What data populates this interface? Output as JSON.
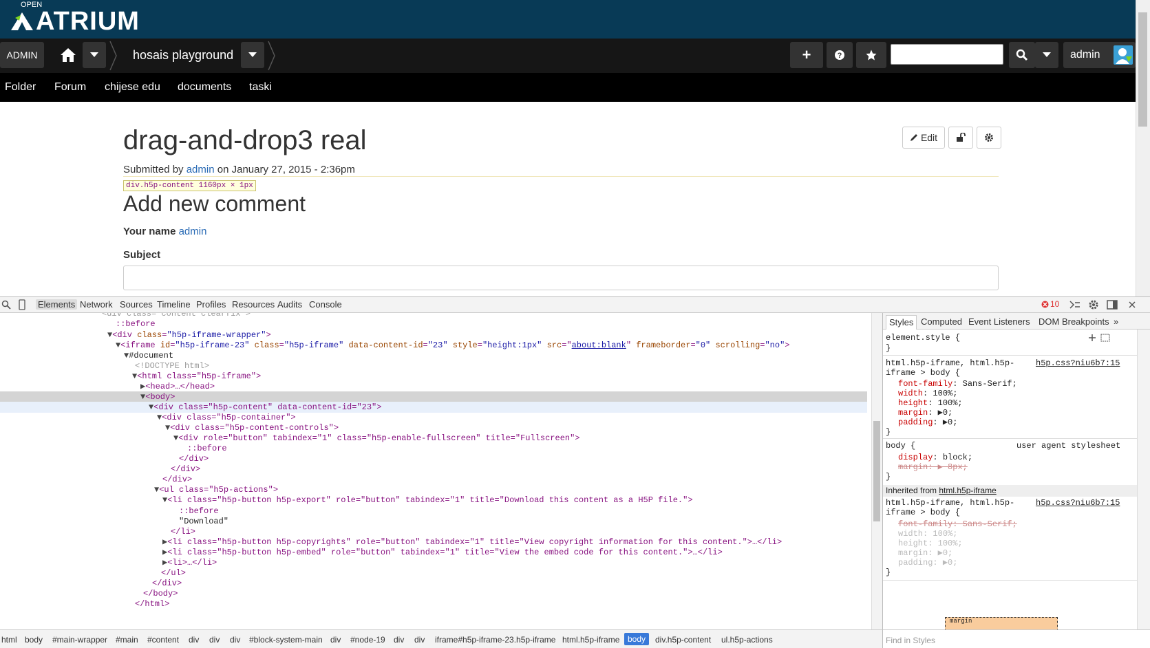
{
  "brand": {
    "small": "OPEN",
    "name": "ATRIUM"
  },
  "toolbar": {
    "admin_label": "ADMIN",
    "space_name": "hosais playground",
    "plus": "+",
    "user_name": "admin",
    "search_value": ""
  },
  "spacebar": {
    "items": [
      "Folder",
      "Forum",
      "chijese edu",
      "documents",
      "taski"
    ]
  },
  "content": {
    "title": "drag-and-drop3 real",
    "submitted_prefix": "Submitted by ",
    "author": "admin",
    "submitted_suffix": " on January 27, 2015 - 2:36pm",
    "tooltip": "div.h5p-content 1160px × 1px",
    "comment_heading": "Add new comment",
    "your_name_label": "Your name",
    "your_name_value": "admin",
    "subject_label": "Subject",
    "edit_label": "Edit"
  },
  "devtools": {
    "tabs": [
      "Elements",
      "Network",
      "Sources",
      "Timeline",
      "Profiles",
      "Resources",
      "Audits",
      "Console"
    ],
    "active_tab": "Elements",
    "error_count": "10",
    "styles_tabs": [
      "Styles",
      "Computed",
      "Event Listeners",
      "DOM Breakpoints"
    ],
    "styles_active": "Styles",
    "inherited_label": "Inherited from ",
    "inherited_link": "html.h5p-iframe",
    "find_placeholder": "Find in Styles",
    "box_model_label": "margin",
    "breadcrumbs": [
      "html",
      "body",
      "#main-wrapper",
      "#main",
      "#content",
      "div",
      "div",
      "div",
      "#block-system-main",
      "div",
      "#node-19",
      "div",
      "div",
      "iframe#h5p-iframe-23.h5p-iframe",
      "html.h5p-iframe",
      "body",
      "div.h5p-content",
      "ul.h5p-actions"
    ],
    "breadcrumb_active": "body"
  },
  "dom": {
    "l0": "<div class=\"content clearfix\">",
    "l1": "::before",
    "l2_tag": "<div ",
    "l2_an": "class",
    "l2_av": "\"h5p-iframe-wrapper\"",
    "l2_end": ">",
    "l3": "<iframe ",
    "l3_a1": "id",
    "l3_v1": "\"h5p-iframe-23\"",
    "l3_a2": "class",
    "l3_v2": "\"h5p-iframe\"",
    "l3_a3": "data-content-id",
    "l3_v3": "\"23\"",
    "l3_a4": "style",
    "l3_v4": "\"height:1px\"",
    "l3_a5": "src",
    "l3_v5": "about:blank",
    "l3_a6": "frameborder",
    "l3_v6": "\"0\"",
    "l3_a7": "scrolling",
    "l3_v7": "\"no\"",
    "l4": "#document",
    "l5": "<!DOCTYPE html>",
    "l6": "<html class=\"h5p-iframe\">",
    "l7": "<head>…</head>",
    "l8": "<body>",
    "l9": "<div class=\"h5p-content\" data-content-id=\"23\">",
    "l10": "<div class=\"h5p-container\">",
    "l11": "<div class=\"h5p-content-controls\">",
    "l12": "<div role=\"button\" tabindex=\"1\" class=\"h5p-enable-fullscreen\" title=\"Fullscreen\">",
    "l13": "::before",
    "l14": "</div>",
    "l15": "</div>",
    "l16": "</div>",
    "l17": "<ul class=\"h5p-actions\">",
    "l18": "<li class=\"h5p-button h5p-export\" role=\"button\" tabindex=\"1\" title=\"Download this content as a H5P file.\">",
    "l19": "::before",
    "l20": "\"Download\"",
    "l21": "</li>",
    "l22": "<li class=\"h5p-button h5p-copyrights\" role=\"button\" tabindex=\"1\" title=\"View copyright information for this content.\">…</li>",
    "l23": "<li class=\"h5p-button h5p-embed\" role=\"button\" tabindex=\"1\" title=\"View the embed code for this content.\">…</li>",
    "l24": "<li>…</li>",
    "l25": "</ul>",
    "l26": "</div>",
    "l27": "</body>",
    "l28": "</html>"
  },
  "styles": {
    "r0_sel": "element.style {",
    "r0_end": "}",
    "r1_sel1": "html.h5p-iframe, html.h5p-",
    "r1_sel2": "iframe > body {",
    "r1_src": "h5p.css?niu6b7:15",
    "r1_props": [
      "font-family",
      "width",
      "height",
      "margin",
      "padding"
    ],
    "r1_vals": [
      "Sans-Serif;",
      "100%;",
      "100%;",
      "▶0;",
      "▶0;"
    ],
    "r1_end": "}",
    "r2_sel": "body {",
    "r2_src": "user agent stylesheet",
    "r2_p1": "display",
    "r2_v1": "block;",
    "r2_p2": "margin",
    "r2_v2": "▶ 8px;",
    "r2_end": "}",
    "r3_sel1": "html.h5p-iframe, html.h5p-",
    "r3_sel2": "iframe > body {",
    "r3_src": "h5p.css?niu6b7:15",
    "r3_props": [
      "font-family",
      "width",
      "height",
      "margin",
      "padding"
    ],
    "r3_vals": [
      "Sans-Serif;",
      "100%;",
      "100%;",
      "▶0;",
      "▶0;"
    ],
    "r3_end": "}"
  },
  "colors": {
    "brand_bar": "#083a56",
    "toolbar": "#161616",
    "link": "#2a6bb5",
    "breadcrumb_active": "#3879d9"
  }
}
